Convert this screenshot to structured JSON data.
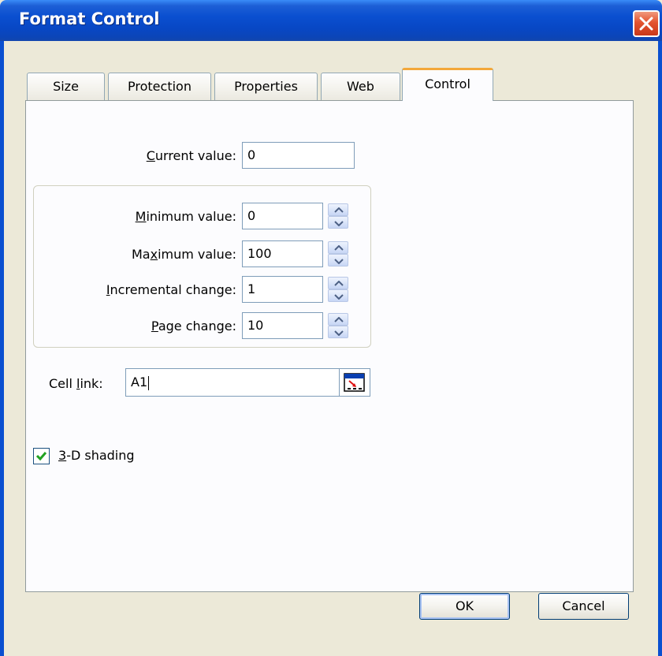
{
  "window": {
    "title": "Format Control"
  },
  "tabs": [
    {
      "label": "Size",
      "active": false
    },
    {
      "label": "Protection",
      "active": false
    },
    {
      "label": "Properties",
      "active": false
    },
    {
      "label": "Web",
      "active": false
    },
    {
      "label": "Control",
      "active": true
    }
  ],
  "fields": {
    "current_value": {
      "prefix": "",
      "accel": "C",
      "rest": "urrent value:",
      "value": "0"
    },
    "minimum_value": {
      "prefix": "",
      "accel": "M",
      "rest": "inimum value:",
      "value": "0"
    },
    "maximum_value": {
      "prefix": "Ma",
      "accel": "x",
      "rest": "imum value:",
      "value": "100"
    },
    "incremental_change": {
      "prefix": "",
      "accel": "I",
      "rest": "ncremental change:",
      "value": "1"
    },
    "page_change": {
      "prefix": "",
      "accel": "P",
      "rest": "age change:",
      "value": "10"
    },
    "cell_link": {
      "prefix": "Cell ",
      "accel": "l",
      "rest": "ink:",
      "value": "A1"
    }
  },
  "shading": {
    "accel": "3",
    "rest": "-D shading",
    "checked": true
  },
  "buttons": {
    "ok": "OK",
    "cancel": "Cancel"
  },
  "colors": {
    "titlebar": "#0a4fd0",
    "dialog_bg": "#ece9d8",
    "active_tab_accent": "#f3a83a",
    "close_button": "#e3532f",
    "checkmark": "#21a121"
  },
  "icons": [
    "close-icon",
    "spin-up-arrow-icon",
    "spin-down-arrow-icon",
    "collapse-dialog-icon",
    "checkmark-icon"
  ]
}
